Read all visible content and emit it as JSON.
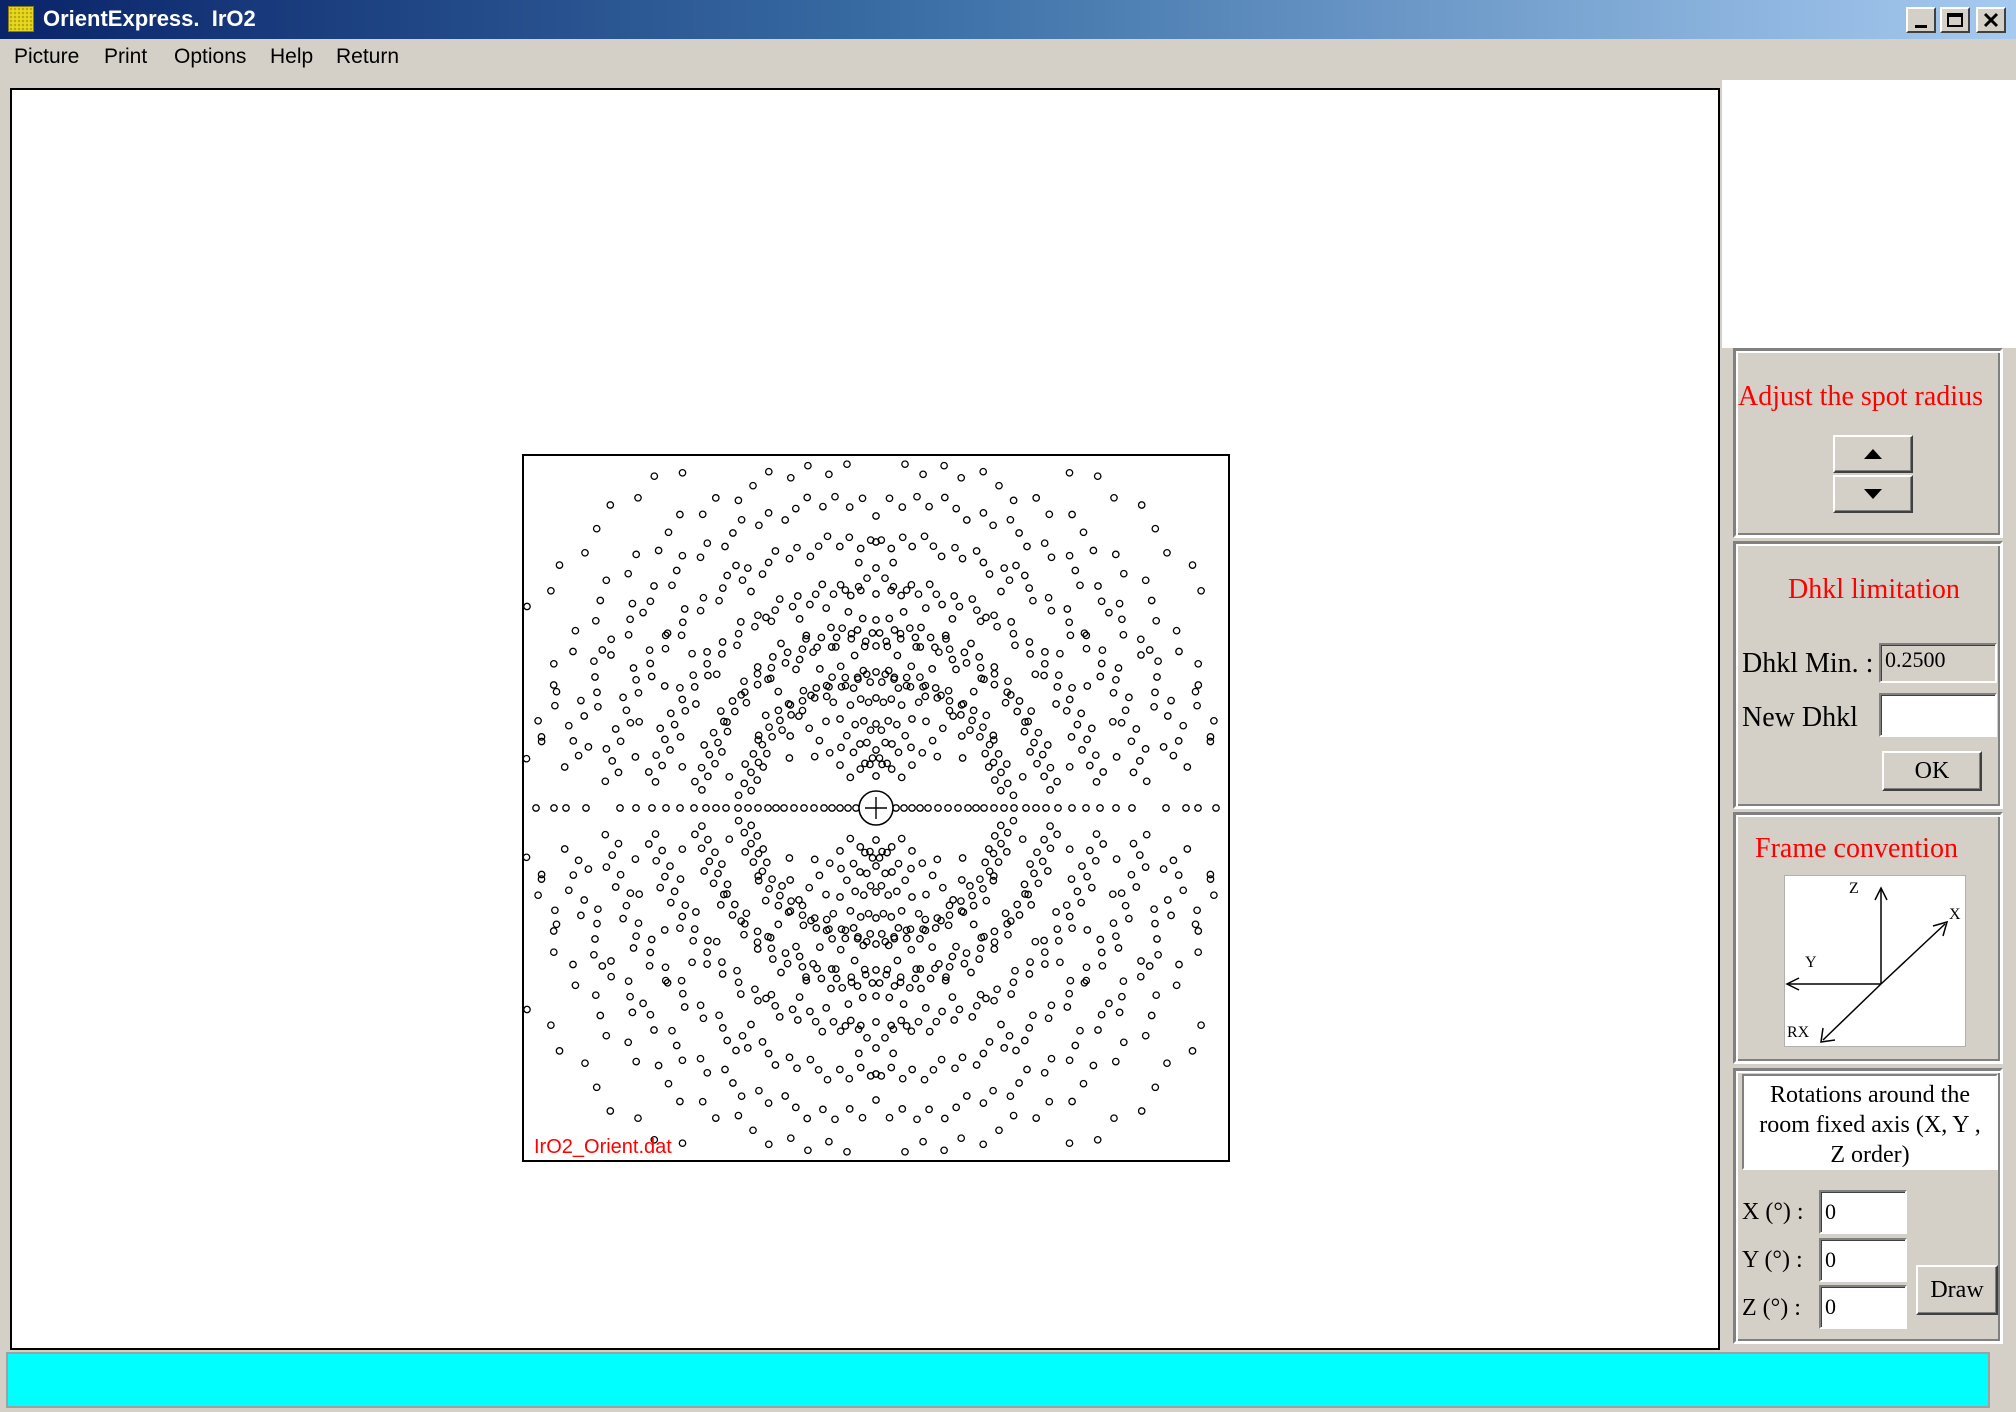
{
  "window": {
    "title": "OrientExpress.  IrO2",
    "controls": {
      "minimize": "minimize-icon",
      "maximize": "maximize-icon",
      "close": "close-icon"
    }
  },
  "menu": {
    "items": [
      "Picture",
      "Print",
      "Options",
      "Help",
      "Return"
    ]
  },
  "pattern": {
    "file_label": "IrO2_Orient.dat",
    "spot_color": "#000000",
    "label_color": "#ff0000",
    "center_marker": "crosshair-circle",
    "rays": [
      {
        "angle": 50,
        "r0": 40,
        "dr": 16,
        "n": 10
      },
      {
        "angle": 68,
        "r0": 42,
        "dr": 18,
        "n": 10
      },
      {
        "angle": 76,
        "r0": 46,
        "dr": 20,
        "n": 9
      },
      {
        "angle": 82,
        "r0": 44,
        "dr": 22,
        "n": 9
      },
      {
        "angle": 86,
        "r0": 50,
        "dr": 28,
        "n": 8
      },
      {
        "angle": 90,
        "r0": 32,
        "dr": 26,
        "n": 11
      },
      {
        "angle": 60,
        "r0": 70,
        "dr": 30,
        "n": 8
      },
      {
        "angle": 40,
        "r0": 80,
        "dr": 32,
        "n": 8
      },
      {
        "angle": 30,
        "r0": 100,
        "dr": 36,
        "n": 7
      },
      {
        "angle": 20,
        "r0": 120,
        "dr": 44,
        "n": 6
      },
      {
        "angle": 12,
        "r0": 150,
        "dr": 48,
        "n": 5
      }
    ],
    "horizontal_row": [
      20,
      28,
      36,
      44,
      52,
      62,
      72,
      82,
      92,
      100,
      108,
      118,
      128,
      138,
      150,
      160,
      170,
      182,
      196,
      210,
      224,
      240,
      256,
      290,
      310,
      322,
      340,
      352
    ]
  },
  "panels": {
    "spot_radius": {
      "title": "Adjust  the spot radius",
      "up_icon": "arrow-up-icon",
      "down_icon": "arrow-down-icon"
    },
    "dhkl": {
      "title": "Dhkl limitation",
      "min_label": "Dhkl Min. :",
      "min_value": "0.2500",
      "new_label": "New Dhkl",
      "new_value": "",
      "ok_label": "OK"
    },
    "frame": {
      "title": "Frame convention",
      "axis_z": "Z",
      "axis_x": "X",
      "axis_y": "Y",
      "axis_rx": "RX"
    },
    "rotations": {
      "heading": "Rotations around the room fixed axis (X,  Y , Z order)",
      "x_label": "X  (°) :",
      "x_value": "0",
      "y_label": "Y  (°) :",
      "y_value": "0",
      "z_label": "Z  (°) :",
      "z_value": "0",
      "draw_label": "Draw"
    }
  },
  "status": {
    "text": "",
    "color": "#00ffff"
  }
}
